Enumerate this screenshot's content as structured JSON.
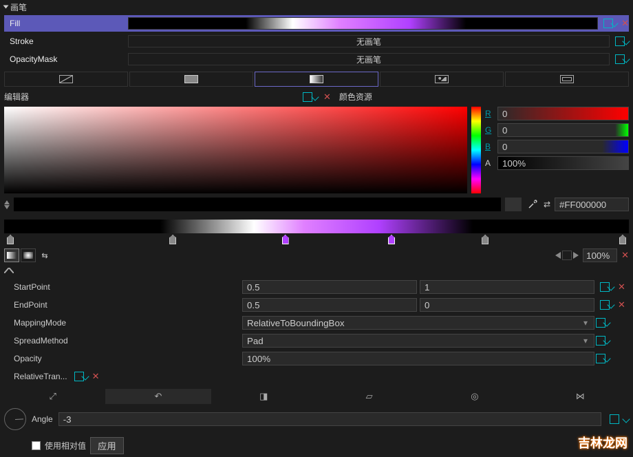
{
  "header": {
    "title": "画笔"
  },
  "brushes": {
    "fill": {
      "label": "Fill"
    },
    "stroke": {
      "label": "Stroke",
      "value": "无画笔"
    },
    "opacityMask": {
      "label": "OpacityMask",
      "value": "无画笔"
    }
  },
  "editor": {
    "label": "编辑器",
    "resources": "颜色资源"
  },
  "rgb": {
    "r_label": "R",
    "r": "0",
    "g_label": "G",
    "g": "0",
    "b_label": "B",
    "b": "0",
    "a_label": "A",
    "a": "100%"
  },
  "hex": {
    "value": "#FF000000",
    "arrows": "⇄"
  },
  "zoom": {
    "value": "100%"
  },
  "props": {
    "startPoint": {
      "label": "StartPoint",
      "x": "0.5",
      "y": "1"
    },
    "endPoint": {
      "label": "EndPoint",
      "x": "0.5",
      "y": "0"
    },
    "mappingMode": {
      "label": "MappingMode",
      "value": "RelativeToBoundingBox"
    },
    "spreadMethod": {
      "label": "SpreadMethod",
      "value": "Pad"
    },
    "opacity": {
      "label": "Opacity",
      "value": "100%"
    },
    "relativeTransform": {
      "label": "RelativeTran..."
    }
  },
  "angle": {
    "label": "Angle",
    "value": "-3"
  },
  "bottom": {
    "useRelative": "使用相对值",
    "apply": "应用"
  },
  "watermark": "吉林龙网"
}
